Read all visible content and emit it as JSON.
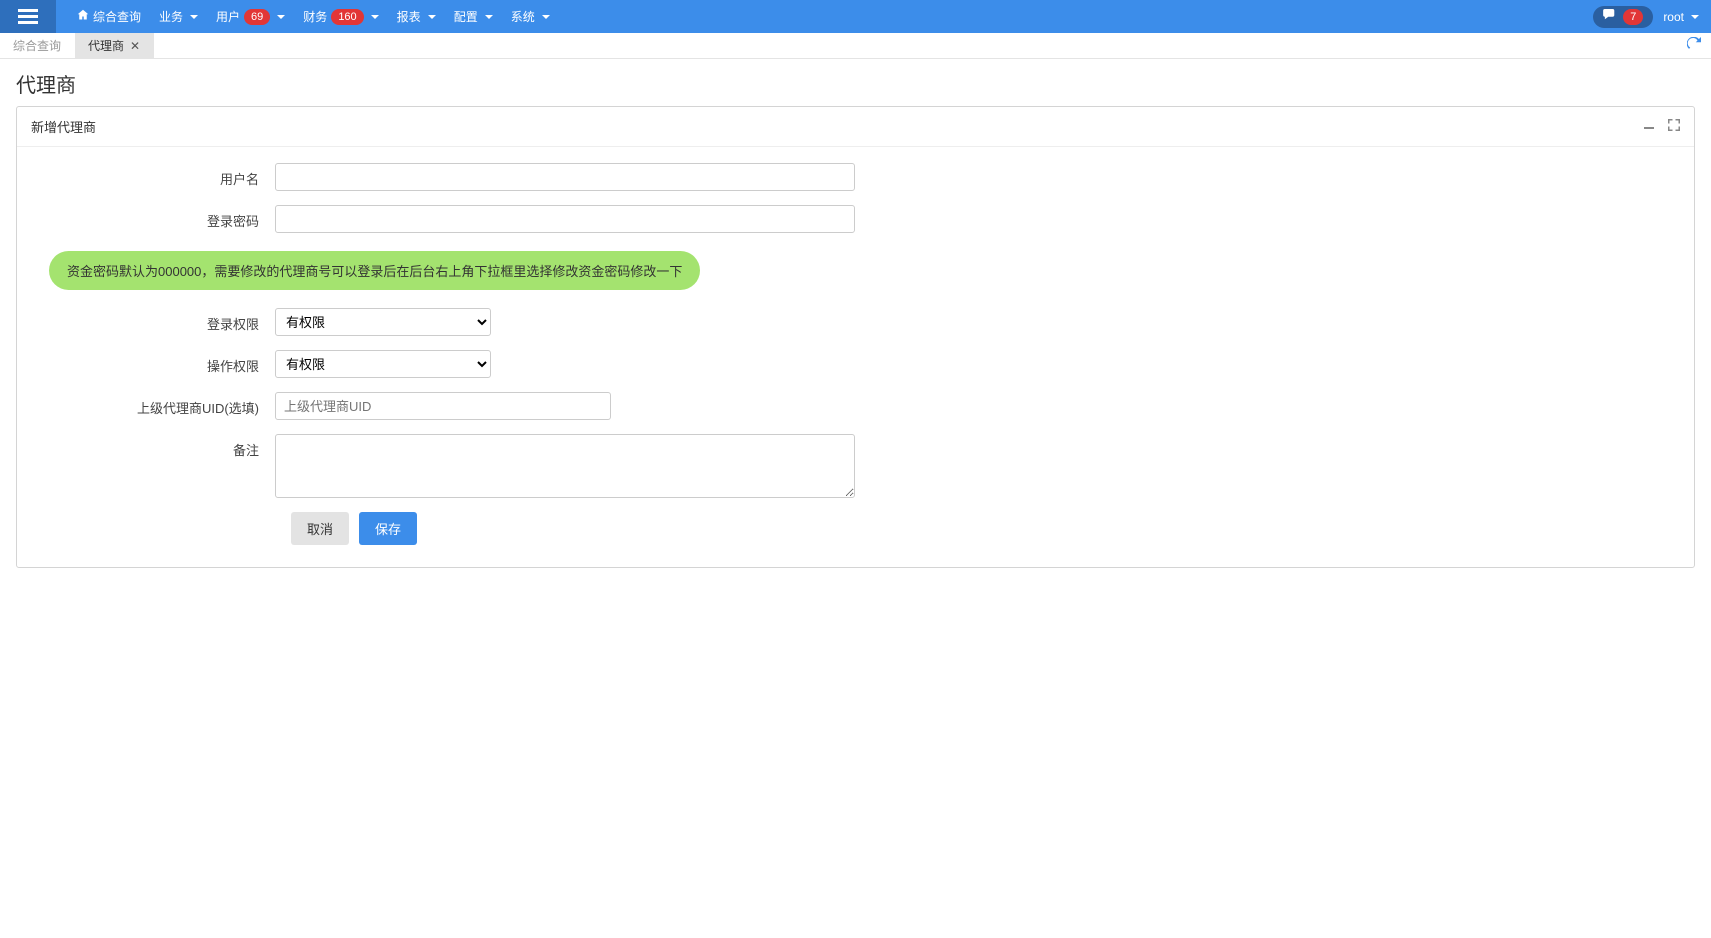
{
  "nav": {
    "home": "综合查询",
    "items": [
      {
        "label": "业务",
        "hasCaret": true
      },
      {
        "label": "用户",
        "badge": "69",
        "hasCaret": true
      },
      {
        "label": "财务",
        "badge": "160",
        "hasCaret": true
      },
      {
        "label": "报表",
        "hasCaret": true
      },
      {
        "label": "配置",
        "hasCaret": true
      },
      {
        "label": "系统",
        "hasCaret": true
      }
    ],
    "chatBadge": "7",
    "user": "root"
  },
  "tabs": {
    "items": [
      {
        "label": "综合查询",
        "active": false
      },
      {
        "label": "代理商",
        "active": true,
        "closable": true
      }
    ]
  },
  "page": {
    "title": "代理商",
    "panelTitle": "新增代理商",
    "form": {
      "usernameLabel": "用户名",
      "passwordLabel": "登录密码",
      "alert": "资金密码默认为000000，需要修改的代理商号可以登录后在后台右上角下拉框里选择修改资金密码修改一下",
      "loginPermLabel": "登录权限",
      "operPermLabel": "操作权限",
      "permOption": "有权限",
      "parentUidLabel": "上级代理商UID(选填)",
      "parentUidPlaceholder": "上级代理商UID",
      "remarkLabel": "备注",
      "cancel": "取消",
      "save": "保存"
    }
  }
}
